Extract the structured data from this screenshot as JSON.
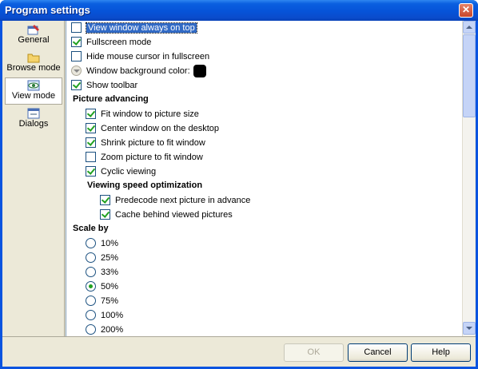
{
  "window": {
    "title": "Program settings",
    "close_icon": "close-icon"
  },
  "sidebar": {
    "items": [
      {
        "label": "General",
        "icon": "general-settings-icon",
        "active": false
      },
      {
        "label": "Browse mode",
        "icon": "folder-icon",
        "active": false
      },
      {
        "label": "View mode",
        "icon": "eye-icon",
        "active": true
      },
      {
        "label": "Dialogs",
        "icon": "dialog-window-icon",
        "active": false
      }
    ]
  },
  "options": {
    "always_on_top": {
      "label": "View window always on top",
      "checked": false
    },
    "fullscreen": {
      "label": "Fullscreen mode",
      "checked": true
    },
    "hide_cursor": {
      "label": "Hide mouse cursor in fullscreen",
      "checked": false
    },
    "background_color": {
      "label": "Window background color:",
      "color": "#000000"
    },
    "show_toolbar": {
      "label": "Show toolbar",
      "checked": true
    }
  },
  "picture_advancing": {
    "header": "Picture advancing",
    "items": [
      {
        "label": "Fit window to picture size",
        "checked": true
      },
      {
        "label": "Center window on the desktop",
        "checked": true
      },
      {
        "label": "Shrink picture to fit window",
        "checked": true
      },
      {
        "label": "Zoom picture to fit window",
        "checked": false
      },
      {
        "label": "Cyclic viewing",
        "checked": true
      }
    ]
  },
  "viewing_speed": {
    "header": "Viewing speed optimization",
    "items": [
      {
        "label": "Predecode next picture in advance",
        "checked": true
      },
      {
        "label": "Cache behind viewed pictures",
        "checked": true
      }
    ]
  },
  "scale": {
    "header": "Scale by",
    "options": [
      "10%",
      "25%",
      "33%",
      "50%",
      "75%",
      "100%",
      "200%"
    ],
    "selected": "50%"
  },
  "buttons": {
    "ok": "OK",
    "cancel": "Cancel",
    "help": "Help"
  },
  "colors": {
    "titlebar": "#0a54e0",
    "selection": "#316ac5",
    "check": "#21a121"
  }
}
